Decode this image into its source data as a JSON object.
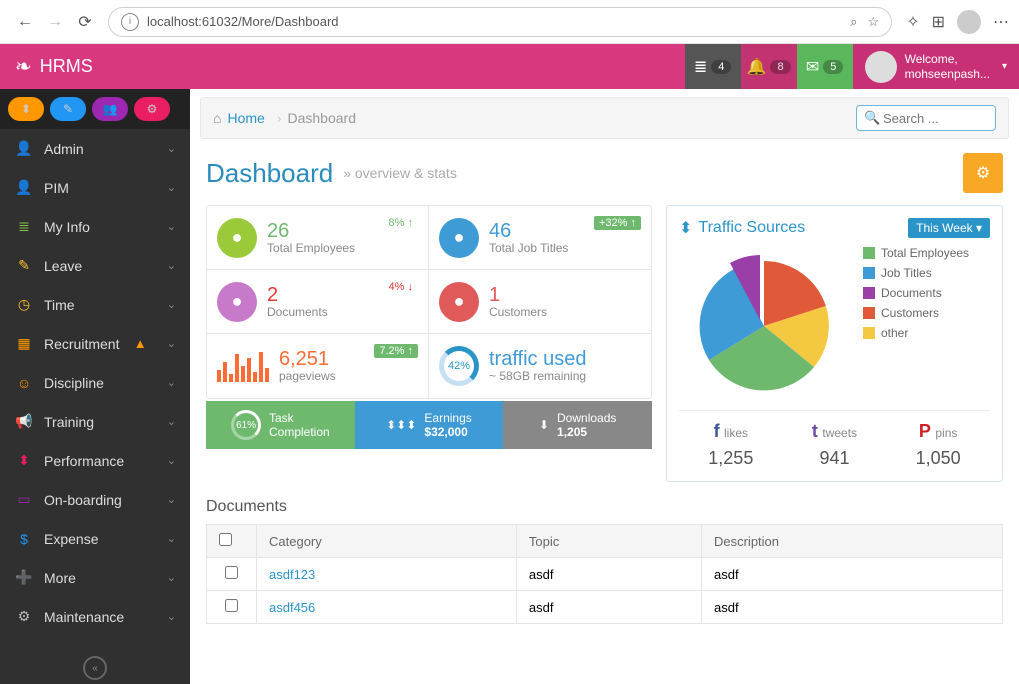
{
  "browser": {
    "url": "localhost:61032/More/Dashboard"
  },
  "brand": "HRMS",
  "notifications": {
    "mail": "4",
    "bell": "8",
    "envelope": "5"
  },
  "user": {
    "welcome": "Welcome,",
    "name": "mohseenpash..."
  },
  "breadcrumb": {
    "home": "Home",
    "current": "Dashboard"
  },
  "search": {
    "placeholder": "Search ..."
  },
  "page": {
    "title": "Dashboard",
    "subtitle": "overview & stats"
  },
  "sidebar": {
    "items": [
      {
        "label": "Admin",
        "icon": "👤",
        "color": "#8ac34a"
      },
      {
        "label": "PIM",
        "icon": "👤",
        "color": "#8ac34a"
      },
      {
        "label": "My Info",
        "icon": "≣",
        "color": "#8ac34a"
      },
      {
        "label": "Leave",
        "icon": "✎",
        "color": "#fbc02d"
      },
      {
        "label": "Time",
        "icon": "◷",
        "color": "#fbc02d"
      },
      {
        "label": "Recruitment",
        "icon": "▦",
        "color": "#ff9800",
        "warn": true
      },
      {
        "label": "Discipline",
        "icon": "☺",
        "color": "#ff9800"
      },
      {
        "label": "Training",
        "icon": "📢",
        "color": "#e53935"
      },
      {
        "label": "Performance",
        "icon": "⬍",
        "color": "#e91e63"
      },
      {
        "label": "On-boarding",
        "icon": "▭",
        "color": "#9c27b0"
      },
      {
        "label": "Expense",
        "icon": "$",
        "color": "#2196f3"
      },
      {
        "label": "More",
        "icon": "➕",
        "color": "#2196f3"
      },
      {
        "label": "Maintenance",
        "icon": "⚙",
        "color": "#bbb"
      }
    ]
  },
  "stats": [
    {
      "value": "26",
      "label": "Total Employees",
      "badge": "8% ↑",
      "badge_bg": "transparent",
      "badge_color": "#6fb96f",
      "icon_bg": "#9ac93a",
      "value_color": "#6fb96f"
    },
    {
      "value": "46",
      "label": "Total Job Titles",
      "badge": "+32% ↑",
      "badge_bg": "#6fb96f",
      "badge_color": "#fff",
      "icon_bg": "#3e9bd6",
      "value_color": "#3e9bd6"
    },
    {
      "value": "2",
      "label": "Documents",
      "badge": "4% ↓",
      "badge_bg": "transparent",
      "badge_color": "#e53935",
      "icon_bg": "#c77ac9",
      "value_color": "#e53935"
    },
    {
      "value": "1",
      "label": "Customers",
      "badge": "",
      "badge_bg": "",
      "badge_color": "",
      "icon_bg": "#e05a5a",
      "value_color": "#e05a5a"
    },
    {
      "value": "6,251",
      "label": "pageviews",
      "badge": "7.2% ↑",
      "badge_bg": "#6fb96f",
      "badge_color": "#fff",
      "icon_bg": "",
      "value_color": "#ff6b35",
      "pageview": true
    },
    {
      "value": "traffic used",
      "label": "~ 58GB remaining",
      "badge": "",
      "icon_bg": "",
      "donut": "42%",
      "value_color": "#3e9bd6"
    }
  ],
  "stat_footer": [
    {
      "pct": "61%",
      "title": "Task",
      "sub": "Completion"
    },
    {
      "title": "Earnings",
      "sub": "$32,000"
    },
    {
      "title": "Downloads",
      "sub": "1,205"
    }
  ],
  "traffic": {
    "title": "Traffic Sources",
    "dropdown": "This Week ▾",
    "legend": [
      {
        "label": "Total Employees",
        "color": "#6fb96f"
      },
      {
        "label": "Job Titles",
        "color": "#3e9bd6"
      },
      {
        "label": "Documents",
        "color": "#9a3ea8"
      },
      {
        "label": "Customers",
        "color": "#e05a3a"
      },
      {
        "label": "other",
        "color": "#f5c842"
      }
    ],
    "social": [
      {
        "icon": "f",
        "label": "likes",
        "value": "1,255",
        "color": "#3b5998"
      },
      {
        "icon": "t",
        "label": "tweets",
        "value": "941",
        "color": "#6b4ba3"
      },
      {
        "icon": "P",
        "label": "pins",
        "value": "1,050",
        "color": "#cb2027"
      }
    ]
  },
  "documents": {
    "title": "Documents",
    "headers": [
      "",
      "Category",
      "Topic",
      "Description"
    ],
    "rows": [
      {
        "category": "asdf123",
        "topic": "asdf",
        "description": "asdf"
      },
      {
        "category": "asdf456",
        "topic": "asdf",
        "description": "asdf"
      }
    ]
  },
  "chart_data": {
    "type": "pie",
    "title": "Traffic Sources",
    "series": [
      {
        "name": "Total Employees",
        "value": 35,
        "color": "#6fb96f"
      },
      {
        "name": "Job Titles",
        "value": 25,
        "color": "#3e9bd6"
      },
      {
        "name": "Documents",
        "value": 8,
        "color": "#9a3ea8"
      },
      {
        "name": "Customers",
        "value": 22,
        "color": "#e05a3a"
      },
      {
        "name": "other",
        "value": 10,
        "color": "#f5c842"
      }
    ]
  }
}
